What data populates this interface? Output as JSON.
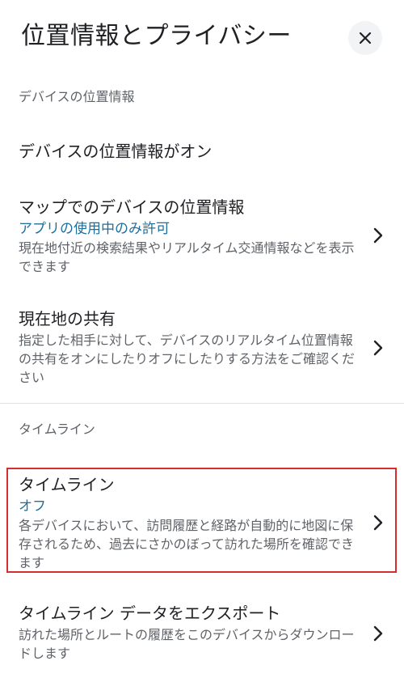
{
  "header": {
    "title": "位置情報とプライバシー",
    "close_icon": "close-icon"
  },
  "sections": {
    "device_location_header": "デバイスの位置情報",
    "timeline_header": "タイムライン"
  },
  "device_location_toggle": {
    "title": "デバイスの位置情報がオン"
  },
  "maps_device_location": {
    "title": "マップでのデバイスの位置情報",
    "status": "アプリの使用中のみ許可",
    "description": "現在地付近の検索結果やリアルタイム交通情報などを表示できます"
  },
  "location_sharing": {
    "title": "現在地の共有",
    "description": "指定した相手に対して、デバイスのリアルタイム位置情報の共有をオンにしたりオフにしたりする方法をご確認ください"
  },
  "timeline": {
    "title": "タイムライン",
    "status": "オフ",
    "description": "各デバイスにおいて、訪問履歴と経路が自動的に地図に保存されるため、過去にさかのぼって訪れた場所を確認できます"
  },
  "export_timeline": {
    "title": "タイムライン データをエクスポート",
    "description": "訪れた場所とルートの履歴をこのデバイスからダウンロードします"
  },
  "colors": {
    "status_text": "#1e6e9e",
    "highlight_border": "#d32f2f",
    "close_button_bg": "#f1f3f4"
  }
}
